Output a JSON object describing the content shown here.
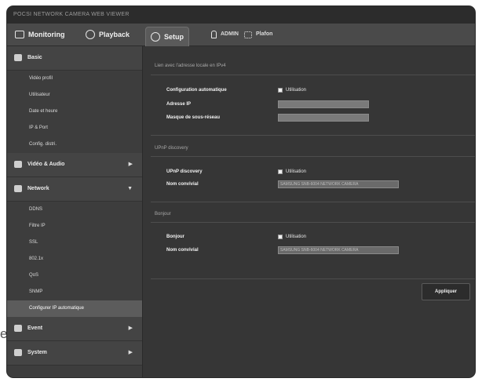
{
  "stray_char": "e",
  "window": {
    "title": "POCSI NETWORK CAMERA WEB VIEWER"
  },
  "topnav": {
    "monitoring": "Monitoring",
    "playback": "Playback",
    "setup": "Setup",
    "user": "ADMIN",
    "extra": "Plafon"
  },
  "sidebar": {
    "basic": {
      "label": "Basic",
      "items": [
        "Vidéo profil",
        "Utilisateur",
        "Date et heure",
        "IP & Port",
        "Config. distri."
      ]
    },
    "video_audio": {
      "label": "Vidéo & Audio"
    },
    "network": {
      "label": "Network",
      "items": [
        "DDNS",
        "Filtre IP",
        "SSL",
        "802.1x",
        "QoS",
        "SNMP",
        "Configurer IP automatique"
      ],
      "active_index": 6
    },
    "event": {
      "label": "Event"
    },
    "system": {
      "label": "System"
    }
  },
  "main": {
    "ipv4": {
      "title": "Lien avec l'adresse locale en IPv4",
      "auto_config_label": "Configuration automatique",
      "auto_config_value": "Utilisation",
      "ip_label": "Adresse IP",
      "mask_label": "Masque de sous-réseau"
    },
    "upnp": {
      "title": "UPnP discovery",
      "discovery_label": "UPnP discovery",
      "discovery_value": "Utilisation",
      "name_label": "Nom convivial",
      "name_value": "SAMSUNG SNB-6004 NETWORK CAMERA"
    },
    "bonjour": {
      "title": "Bonjour",
      "bonjour_label": "Bonjour",
      "bonjour_value": "Utilisation",
      "name_label": "Nom convivial",
      "name_value": "SAMSUNG SNB-6004 NETWORK CAMERA"
    },
    "apply_label": "Appliquer"
  }
}
